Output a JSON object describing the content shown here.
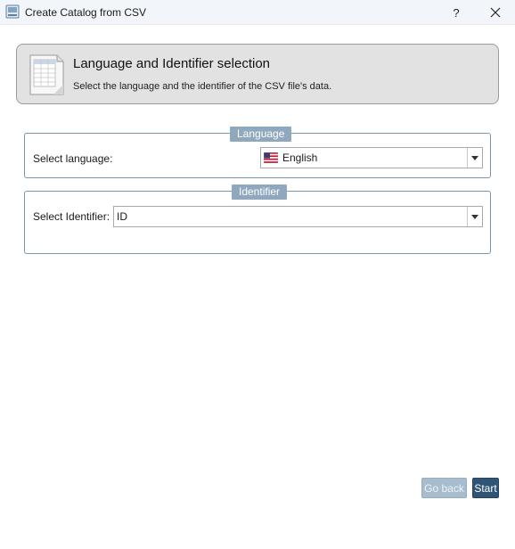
{
  "window": {
    "title": "Create Catalog from CSV",
    "help_label": "?",
    "close_label": "✕"
  },
  "header": {
    "title": "Language and Identifier selection",
    "subtitle": "Select the language and the identifier of the CSV file's data."
  },
  "language_group": {
    "legend": "Language",
    "label": "Select language:",
    "selected": "English",
    "flag_icon": "us-flag-icon"
  },
  "identifier_group": {
    "legend": "Identifier",
    "label": "Select Identifier:",
    "selected": "ID"
  },
  "buttons": {
    "go_back": "Go back",
    "start": "Start"
  },
  "colors": {
    "legend_bg": "#8fa8bd",
    "group_border": "#7a96ad",
    "start_bg": "#2e5577",
    "go_back_disabled_bg": "#a7bccd"
  }
}
